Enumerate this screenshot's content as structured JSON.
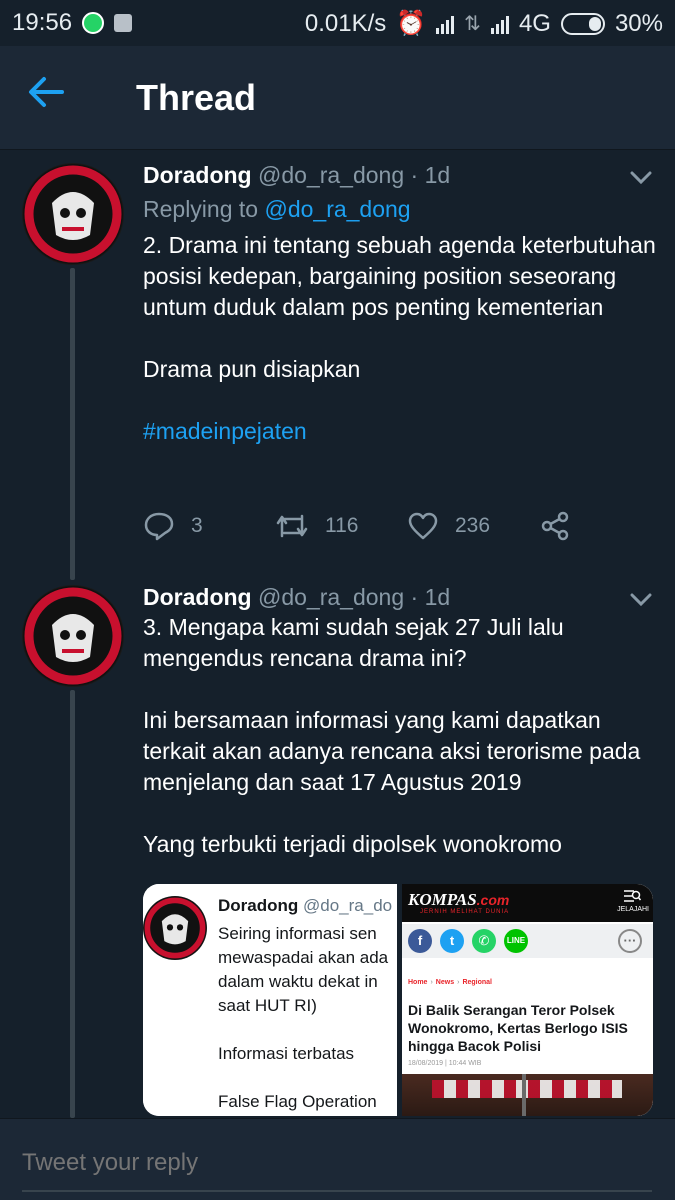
{
  "status_bar": {
    "time": "19:56",
    "speed": "0.01K/s",
    "network": "4G",
    "battery": "30%"
  },
  "header": {
    "title": "Thread",
    "back_icon": "arrow-left-icon"
  },
  "tweets": [
    {
      "name": "Doradong",
      "handle": "@do_ra_dong · 1d",
      "replying_prefix": "Replying to",
      "replying_to": "@do_ra_dong",
      "paragraphs": [
        "2. Drama ini tentang sebuah agenda keterbutuhan posisi kedepan, bargaining position seseorang untum duduk dalam pos penting kementerian",
        "Drama pun disiapkan"
      ],
      "hashtag": "#madeinpejaten",
      "replies": "3",
      "retweets": "116",
      "likes": "236"
    },
    {
      "name": "Doradong",
      "handle": "@do_ra_dong · 1d",
      "paragraphs": [
        "3. Mengapa kami sudah sejak 27 Juli lalu mengendus rencana drama ini?",
        "Ini bersamaan informasi yang kami dapatkan terkait akan adanya rencana aksi terorisme pada menjelang dan saat 17 Agustus 2019",
        "Yang terbukti terjadi dipolsek wonokromo"
      ],
      "embed": {
        "left": {
          "name": "Doradong",
          "handle": "@do_ra_do",
          "lines": [
            "Seiring informasi sen",
            "mewaspadai akan ada",
            "dalam waktu dekat in",
            "saat HUT RI)"
          ],
          "line2": "Informasi terbatas",
          "line3": "False Flag Operation"
        },
        "right": {
          "logo": "KOMPAS",
          "logo_suffix": ".com",
          "tagline": "JERNIH MELIHAT DUNIA",
          "menu_label": "JELAJAHI",
          "crumbs": [
            "Home",
            "News",
            "Regional"
          ],
          "headline": "Di Balik Serangan Teror Polsek Wonokromo, Kertas Berlogo ISIS hingga Bacok Polisi",
          "date": "18/08/2019 | 10:44 WIB"
        }
      }
    }
  ],
  "reply": {
    "placeholder": "Tweet your reply"
  },
  "colors": {
    "background": "#15202b",
    "accent": "#1da1f2",
    "muted": "#8899a6"
  }
}
